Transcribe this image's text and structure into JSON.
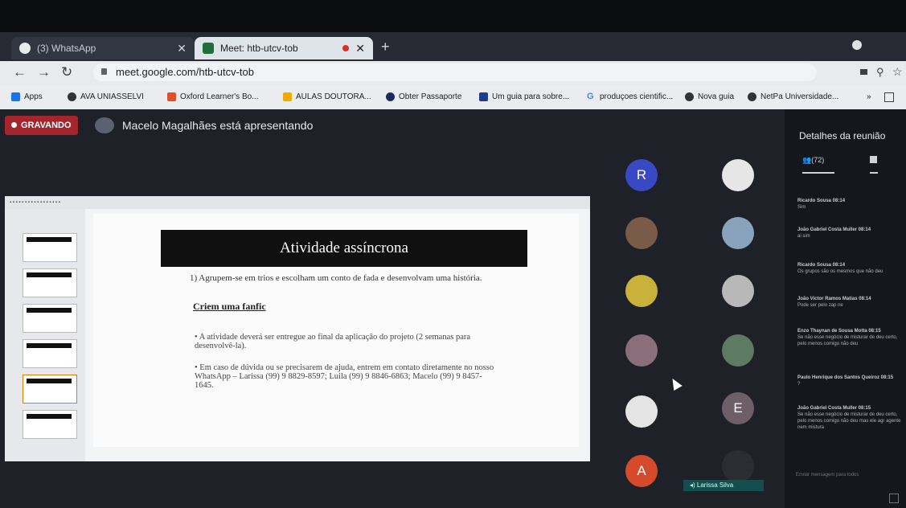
{
  "browser": {
    "tabs": [
      {
        "label": "(3) WhatsApp",
        "active": false,
        "icon": "whatsapp-icon"
      },
      {
        "label": "Meet: htb-utcv-tob",
        "active": true,
        "icon": "meet-icon"
      }
    ],
    "close_glyph": "✕",
    "new_tab_glyph": "+",
    "url": "meet.google.com/htb-utcv-tob",
    "bookmarks": [
      {
        "label": "Apps",
        "icon": "apps-grid-icon"
      },
      {
        "label": "AVA UNIASSELVI",
        "icon": "globe-icon"
      },
      {
        "label": "Oxford Learner's Bo...",
        "icon": "oxford-icon"
      },
      {
        "label": "AULAS DOUTORA...",
        "icon": "folder-icon"
      },
      {
        "label": "Obter Passaporte",
        "icon": "passport-icon"
      },
      {
        "label": "Um guia para sobre...",
        "icon": "book-icon"
      },
      {
        "label": "produçoes cientific...",
        "icon": "google-icon"
      },
      {
        "label": "Nova guia",
        "icon": "globe-icon"
      },
      {
        "label": "NetPa Universidade...",
        "icon": "globe-icon"
      }
    ]
  },
  "meeting": {
    "recording_label": "GRAVANDO",
    "presenter_text": "Macelo Magalhães está apresentando",
    "tiles": [
      {
        "letter": "R",
        "color": "#3949c5"
      },
      {
        "letter": "",
        "color": "#e6e6e6"
      },
      {
        "letter": "",
        "color": "#7a5a48"
      },
      {
        "letter": "",
        "color": "#8aa3bd"
      },
      {
        "letter": "",
        "color": "#c9b13a"
      },
      {
        "letter": "",
        "color": "#b8b8b8"
      },
      {
        "letter": "",
        "color": "#8a6e7a"
      },
      {
        "letter": "",
        "color": "#5d7a62"
      },
      {
        "letter": "",
        "color": "#e4e4e4"
      },
      {
        "letter": "E",
        "color": "#6e5e68"
      },
      {
        "letter": "A",
        "color": "#d44a2a"
      },
      {
        "letter": "",
        "color": "#2c2d33"
      }
    ],
    "speaker_name": "Larissa Silva"
  },
  "slide": {
    "title": "Atividade assíncrona",
    "item1": "1)   Agrupem-se em trios e escolham um conto de fada e desenvolvam uma história.",
    "subtitle": "Criem uma fanfic",
    "bullet1": "• A atividade deverá ser entregue ao final da aplicação do projeto (2 semanas para desenvolvê-la).",
    "bullet2": "• Em caso de dúvida ou se precisarem de ajuda, entrem em contato diretamente no nosso WhatsApp – Larissa (99) 9 8829-8597; Luila (99) 9 8846-6863; Macelo (99) 9 8457-1645."
  },
  "panel": {
    "title": "Detalhes da reunião",
    "people_count": "(72)",
    "messages": [
      {
        "who": "Ricardo Sousa  08:14",
        "text": "Sim"
      },
      {
        "who": "João Gabriel Costa Muller  08:14",
        "text": "ai sim"
      },
      {
        "who": "Ricardo Sousa  08:14",
        "text": "Os grupos são os mesmos que não deu"
      },
      {
        "who": "João Victor Ramos Matias  08:14",
        "text": "Pode ser pelo zap ne"
      },
      {
        "who": "Enzo Thaynan de Sousa Motta  08:15",
        "text": "Se não esse negócio de misturar de deu certo, pelo menos comigo não deu"
      },
      {
        "who": "Paulo Henrique dos Santos Queiroz  08:15",
        "text": "?"
      },
      {
        "who": "João Gabriel Costa Muller  08:15",
        "text": "Se não esse negócio de misturar de deu certo, pelo menos comigo não deu mas ele agr agente nem mistura"
      }
    ],
    "input_placeholder": "Enviar mensagem para todos"
  }
}
